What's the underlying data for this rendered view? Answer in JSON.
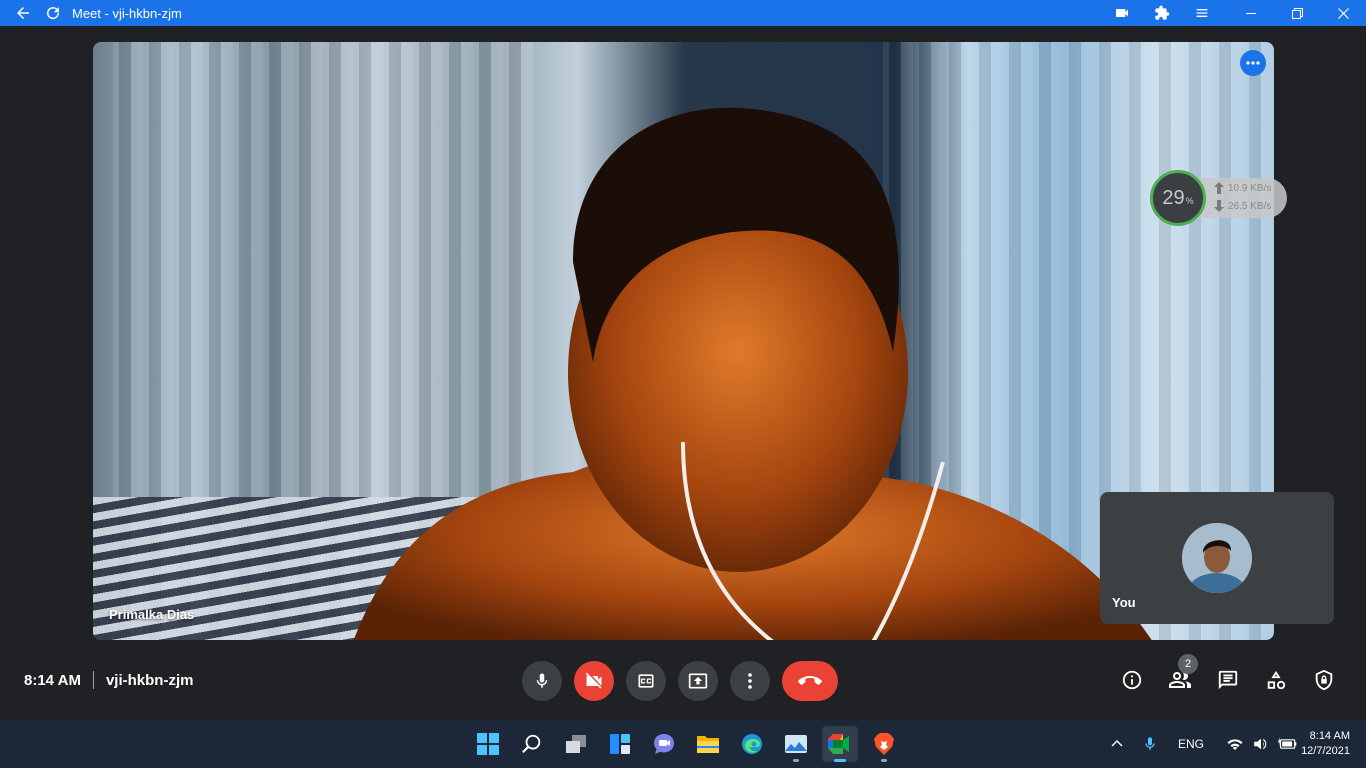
{
  "window": {
    "title": "Meet - vji-hkbn-zjm"
  },
  "stage": {
    "participant_name": "Primalka Dias"
  },
  "network": {
    "percent": "29",
    "percent_unit": "%",
    "upload": "10.9 KB/s",
    "download": "26.5 KB/s",
    "accent": "#4caf50"
  },
  "self_tile": {
    "label": "You"
  },
  "bottom": {
    "time": "8:14 AM",
    "meeting_code": "vji-hkbn-zjm",
    "participants_count": "2",
    "colors": {
      "danger": "#ea4335",
      "control_bg": "#3c4043"
    }
  },
  "taskbar": {
    "icons": [
      "windows-start-icon",
      "search-icon",
      "task-view-icon",
      "widgets-icon",
      "teams-chat-icon",
      "file-explorer-icon",
      "edge-icon",
      "photos-icon",
      "google-meet-icon",
      "brave-icon"
    ],
    "language": "ENG",
    "time": "8:14 AM",
    "date": "12/7/2021"
  }
}
